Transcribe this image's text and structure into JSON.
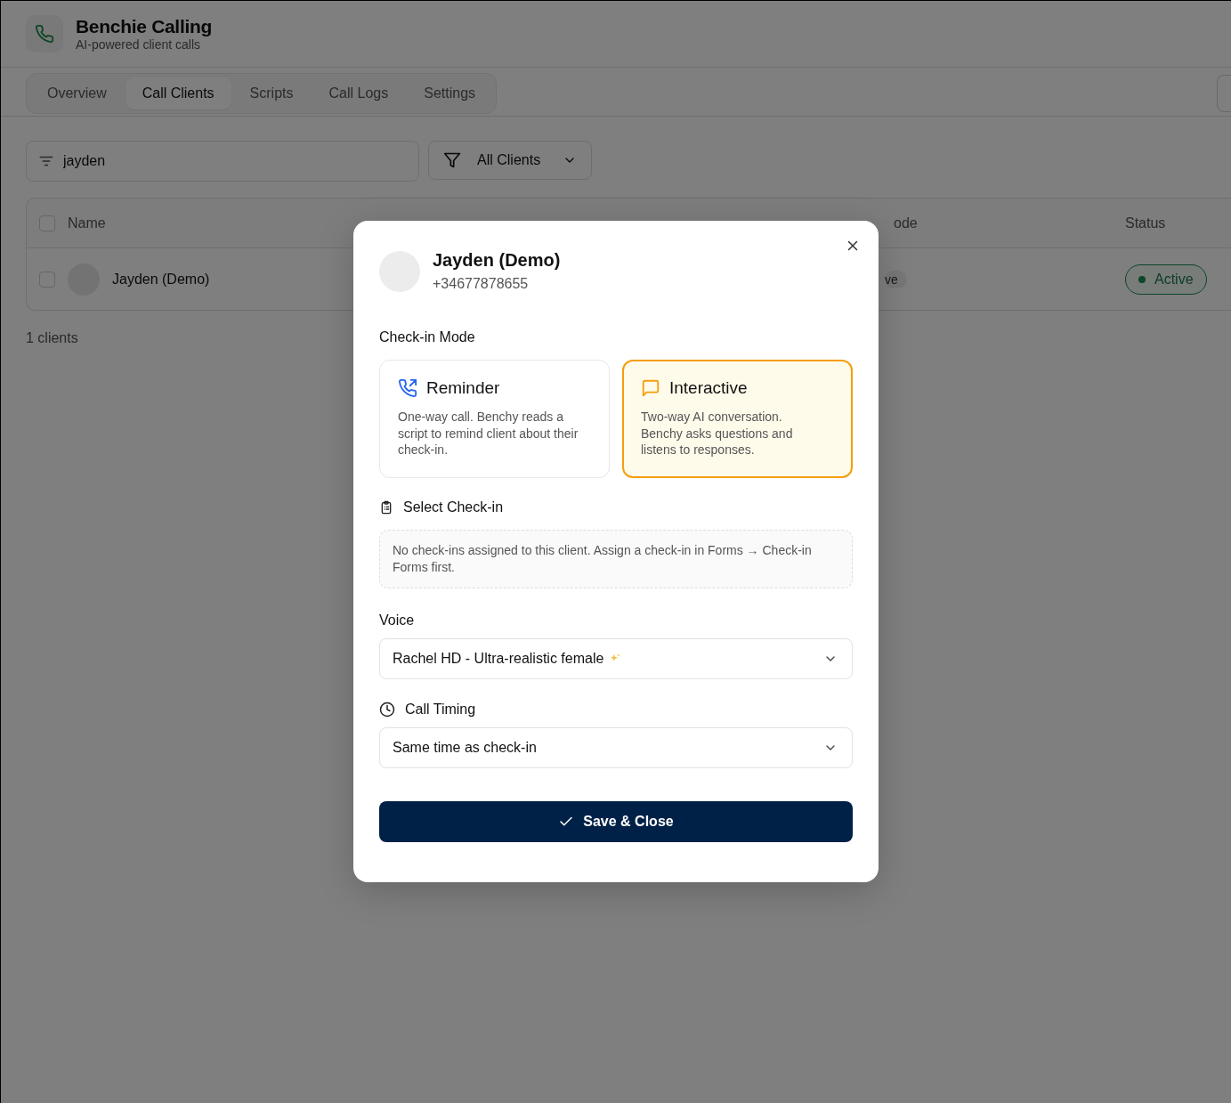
{
  "app": {
    "title": "Benchie Calling",
    "subtitle": "AI-powered client calls"
  },
  "tabs": [
    {
      "label": "Overview",
      "selected": false
    },
    {
      "label": "Call Clients",
      "selected": true
    },
    {
      "label": "Scripts",
      "selected": false
    },
    {
      "label": "Call Logs",
      "selected": false
    },
    {
      "label": "Settings",
      "selected": false
    }
  ],
  "search": {
    "value": "jayden"
  },
  "filter": {
    "label": "All Clients"
  },
  "table": {
    "select_all": {
      "checked": false
    },
    "columns": [
      {
        "kind": "name",
        "label": "Name"
      },
      {
        "kind": "badge",
        "label": "ode"
      },
      {
        "kind": "status",
        "label": "Status"
      }
    ],
    "rows": [
      {
        "checked": false,
        "name": "Jayden (Demo)",
        "column_3": "ve",
        "status": "Active"
      }
    ]
  },
  "count": "1 clients",
  "dialog": {
    "client_name": "Jayden (Demo)",
    "phone": "+34677878655",
    "check_in_mode": {
      "label": "Check-in Mode",
      "options": [
        {
          "kind": "phone",
          "title": "Reminder",
          "description": "One-way call. Benchy reads a script to remind client about their check-in.",
          "selected": false
        },
        {
          "kind": "chat",
          "title": "Interactive",
          "description": "Two-way AI conversation. Benchy asks questions and listens to responses.",
          "selected": true
        }
      ]
    },
    "select_check_in": {
      "label": "Select Check-in",
      "notice": "No check-ins assigned to this client. Assign a check-in in Forms → Check-in Forms first."
    },
    "voice": {
      "label": "Voice",
      "value": "Rachel HD - Ultra-realistic female"
    },
    "call_timing": {
      "label": "Call Timing",
      "value": "Same time as check-in"
    },
    "save_button": {
      "label": "Save & Close"
    }
  }
}
